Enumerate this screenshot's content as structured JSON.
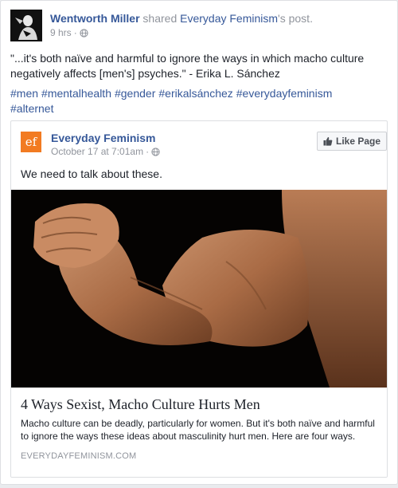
{
  "post": {
    "author": "Wentworth Miller",
    "action_text": " shared ",
    "shared_page": "Everyday Feminism",
    "possessive": "'s post.",
    "time": "9 hrs",
    "body": "\"...it's both naïve and harmful to ignore the ways in which macho culture negatively affects [men's] psyches.\" - Erika L. Sánchez",
    "hashtags": [
      "#men",
      "#mentalhealth",
      "#gender",
      "#erikalsánchez",
      "#everydayfeminism",
      "#alternet"
    ]
  },
  "shared_post": {
    "logo_text": "ef",
    "page_name": "Everyday Feminism",
    "time": "October 17 at 7:01am",
    "like_button": "Like Page",
    "text": "We need to talk about these.",
    "link": {
      "title": "4 Ways Sexist, Macho Culture Hurts Men",
      "description": "Macho culture can be deadly, particularly for women. But it's both naïve and harmful to ignore the ways these ideas about masculinity hurt men. Here are four ways.",
      "domain": "EVERYDAYFEMINISM.COM"
    }
  },
  "icons": {
    "privacy": "globe-icon",
    "like": "thumbs-up-icon"
  },
  "colors": {
    "link_blue": "#365899",
    "meta_gray": "#90949c",
    "ef_orange": "#f27b22"
  }
}
